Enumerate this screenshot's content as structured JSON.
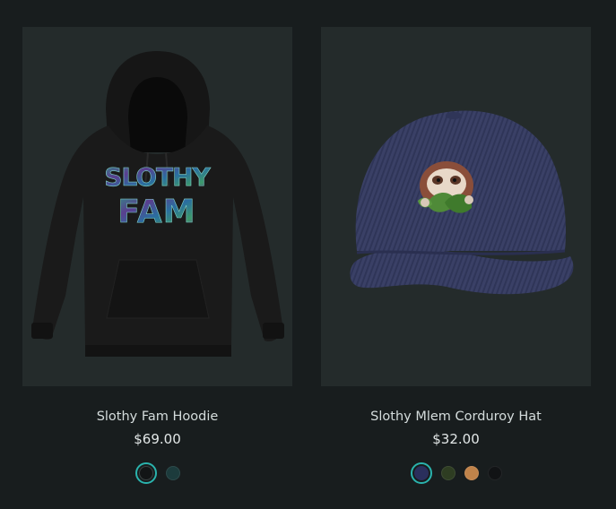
{
  "products": [
    {
      "title": "Slothy Fam Hoodie",
      "price": "$69.00",
      "image_text": [
        "SLOTHY",
        "FAM"
      ],
      "swatches": [
        {
          "name": "Black",
          "color": "#121516",
          "selected": true
        },
        {
          "name": "Dark Teal",
          "color": "#1c3b3c",
          "selected": false
        }
      ]
    },
    {
      "title": "Slothy Mlem Corduroy Hat",
      "price": "$32.00",
      "swatches": [
        {
          "name": "Navy",
          "color": "#2a2f5c",
          "selected": true
        },
        {
          "name": "Olive",
          "color": "#2e3d22",
          "selected": false
        },
        {
          "name": "Camel",
          "color": "#c0834a",
          "selected": false
        },
        {
          "name": "Black",
          "color": "#111315",
          "selected": false
        }
      ]
    }
  ],
  "colors": {
    "page_background": "#181d1e",
    "card_background": "#242b2b",
    "selected_ring": "#2ab3ad"
  }
}
